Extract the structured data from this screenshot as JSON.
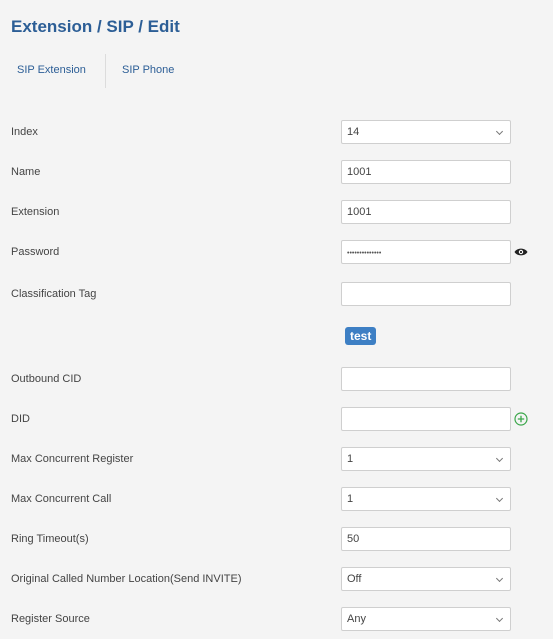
{
  "page_title": "Extension / SIP / Edit",
  "tabs": [
    {
      "label": "SIP Extension"
    },
    {
      "label": "SIP Phone"
    }
  ],
  "form": {
    "index": {
      "label": "Index",
      "value": "14"
    },
    "name": {
      "label": "Name",
      "value": "1001"
    },
    "extension": {
      "label": "Extension",
      "value": "1001"
    },
    "password": {
      "label": "Password",
      "value": "••••••••••••••"
    },
    "classification_tag": {
      "label": "Classification Tag",
      "value": "",
      "tags": [
        "test"
      ]
    },
    "outbound_cid": {
      "label": "Outbound CID",
      "value": ""
    },
    "did": {
      "label": "DID",
      "value": ""
    },
    "max_concurrent_register": {
      "label": "Max Concurrent Register",
      "value": "1"
    },
    "max_concurrent_call": {
      "label": "Max Concurrent Call",
      "value": "1"
    },
    "ring_timeout": {
      "label": "Ring Timeout(s)",
      "value": "50"
    },
    "original_called_number_location": {
      "label": "Original Called Number Location(Send INVITE)",
      "value": "Off"
    },
    "register_source": {
      "label": "Register Source",
      "value": "Any"
    }
  },
  "icons": {
    "password_toggle": "eye-icon",
    "did_add": "plus-circle-icon",
    "select": "chevron-down-icon"
  },
  "colors": {
    "title": "#2c5e96",
    "tag_badge": "#3d7fc4",
    "add_icon": "#3aa64a"
  }
}
